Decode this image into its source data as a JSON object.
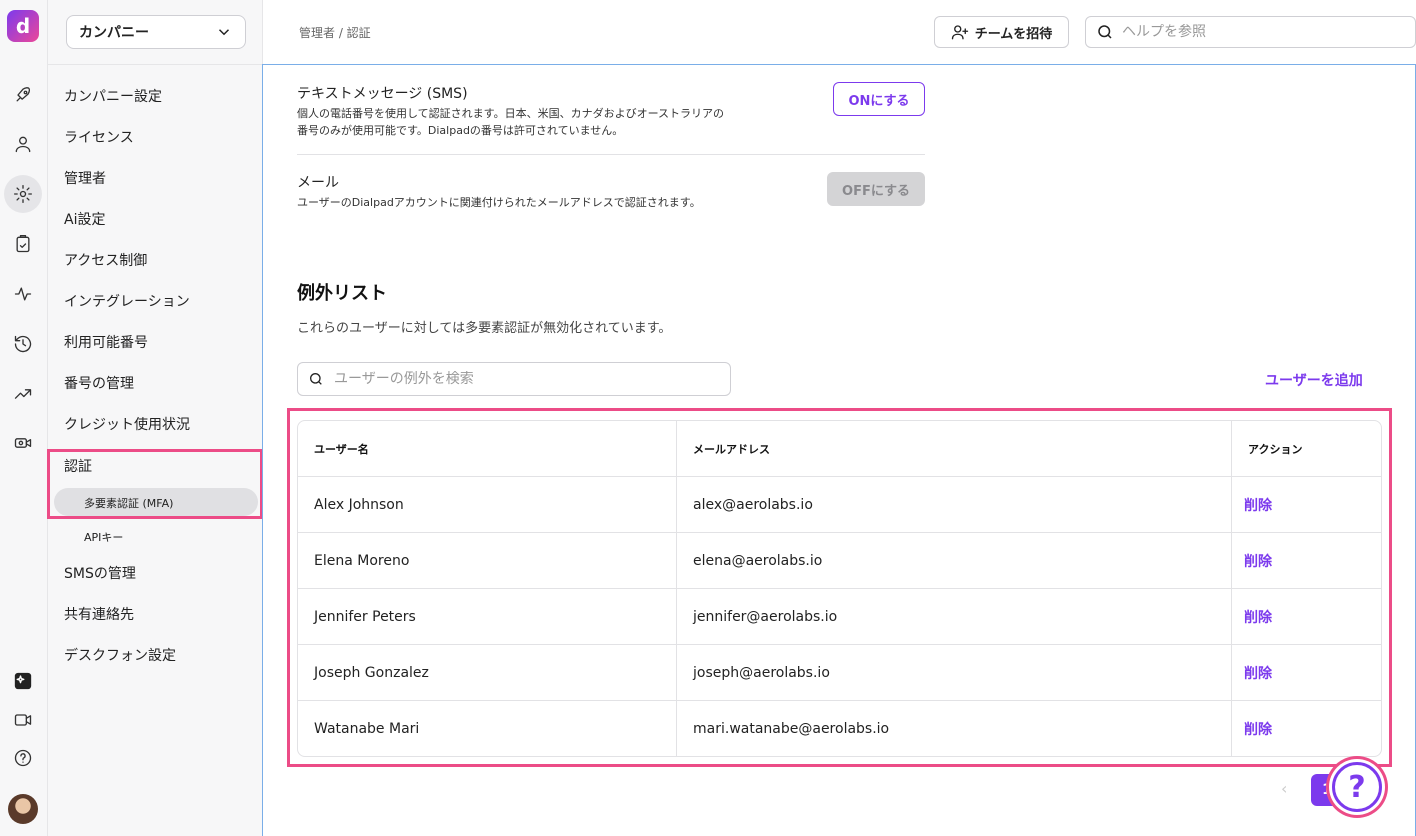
{
  "company_selector": {
    "label": "カンパニー"
  },
  "breadcrumb": "管理者 / 認証",
  "header": {
    "invite_label": "チームを招待",
    "help_placeholder": "ヘルプを参照"
  },
  "sidebar": {
    "items": [
      {
        "label": "カンパニー設定"
      },
      {
        "label": "ライセンス"
      },
      {
        "label": "管理者"
      },
      {
        "label": "Ai設定"
      },
      {
        "label": "アクセス制御"
      },
      {
        "label": "インテグレーション"
      },
      {
        "label": "利用可能番号"
      },
      {
        "label": "番号の管理"
      },
      {
        "label": "クレジット使用状況"
      },
      {
        "label": "認証"
      },
      {
        "label": "SMSの管理"
      },
      {
        "label": "共有連絡先"
      },
      {
        "label": "デスクフォン設定"
      }
    ],
    "sub_items": [
      {
        "label": "多要素認証 (MFA)"
      },
      {
        "label": "APIキー"
      }
    ]
  },
  "settings": {
    "sms": {
      "title": "テキストメッセージ (SMS)",
      "desc_line1": "個人の電話番号を使用して認証されます。日本、米国、カナダおよびオーストラリアの",
      "desc_line2": "番号のみが使用可能です。Dialpadの番号は許可されていません。",
      "button": "ONにする"
    },
    "email": {
      "title": "メール",
      "desc": "ユーザーのDialpadアカウントに関連付けられたメールアドレスで認証されます。",
      "button": "OFFにする"
    }
  },
  "exceptions": {
    "title": "例外リスト",
    "desc": "これらのユーザーに対しては多要素認証が無効化されています。",
    "search_placeholder": "ユーザーの例外を検索",
    "add_user": "ユーザーを追加",
    "columns": [
      "ユーザー名",
      "メールアドレス",
      "アクション"
    ],
    "rows": [
      {
        "name": "Alex Johnson",
        "email": "alex@aerolabs.io",
        "action": "削除"
      },
      {
        "name": "Elena Moreno",
        "email": "elena@aerolabs.io",
        "action": "削除"
      },
      {
        "name": "Jennifer Peters",
        "email": "jennifer@aerolabs.io",
        "action": "削除"
      },
      {
        "name": "Joseph Gonzalez",
        "email": "joseph@aerolabs.io",
        "action": "削除"
      },
      {
        "name": "Watanabe Mari",
        "email": "mari.watanabe@aerolabs.io",
        "action": "削除"
      }
    ]
  },
  "pagination": {
    "prev": "‹",
    "current": "1"
  },
  "help_fab": "?",
  "colors": {
    "accent": "#7c3aed",
    "highlight": "#ec4c87",
    "focus": "#7aaee8"
  }
}
